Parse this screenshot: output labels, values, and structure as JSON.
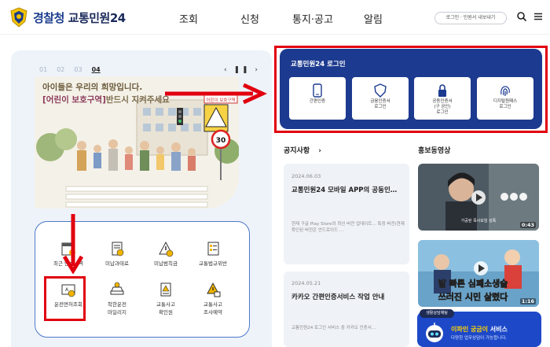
{
  "header": {
    "logo_part1": "경찰청",
    "logo_part2": "교통민원24",
    "nav": [
      "조회",
      "신청",
      "통지·공고",
      "알림"
    ],
    "login_pill": "로그인 · 민원서 내보내기",
    "icons": [
      "search-icon",
      "menu-icon"
    ]
  },
  "banner": {
    "slide_numbers": [
      "01",
      "02",
      "03",
      "04"
    ],
    "active_slide": "04",
    "controls": "‹ ❚❚ ›",
    "title_line1": "아이들은 우리의 희망입니다.",
    "title_line2_highlight": "[어린이 보호구역]",
    "title_line2_rest": "반드시 지켜주세요",
    "speed_sign": "30",
    "zone_sign": "어린이 보호구역"
  },
  "services": [
    {
      "label": "최근 단속내역",
      "icon": "calendar-icon"
    },
    {
      "label": "미납과태료",
      "icon": "coin-doc-icon"
    },
    {
      "label": "미납범칙금",
      "icon": "warning-coin-icon"
    },
    {
      "label": "교통법규위반",
      "icon": "doc-list-icon"
    },
    {
      "label": "운전면허조회",
      "icon": "license-icon"
    },
    {
      "label": "착한운전\n마일리지",
      "icon": "car-coin-icon"
    },
    {
      "label": "교통사고\n확인원",
      "icon": "accident-doc-icon"
    },
    {
      "label": "교통사고\n조사예약",
      "icon": "accident-calendar-icon"
    }
  ],
  "login": {
    "title": "교통민원24 로그인",
    "buttons": [
      {
        "label": "간편인증",
        "icon": "phone-icon"
      },
      {
        "label": "금융인증서\n로그인",
        "icon": "shield-icon"
      },
      {
        "label": "공동인증서\n(구 공인)\n로그인",
        "icon": "lock-icon"
      },
      {
        "label": "디지털원패스\n로그인",
        "icon": "fingerprint-icon"
      }
    ]
  },
  "notices": {
    "title": "공지사항",
    "arrow": "›",
    "items": [
      {
        "date": "2024.06.03",
        "title": "교통민원24 모바일 APP의 공동인…",
        "body": "현재 구글 Play Store의 최신 버전 업데이트… 특정 버전(현재 확인된 버전은 안드로이드 …"
      },
      {
        "date": "2024.05.21",
        "title": "카카오 간편인증서비스 작업 안내",
        "body": "교통민원24 로그인 서비스 중 카카오 인증서…"
      }
    ]
  },
  "videos": {
    "title": "홍보동영상",
    "items": [
      {
        "duration": "0:43",
        "caption": "가공된 목사모임 성폭"
      },
      {
        "duration": "1:16",
        "caption_line1": "발 빠른 심폐소생술",
        "caption_line2": "쓰러진 시민 살렸다"
      }
    ]
  },
  "chat": {
    "badge": "생활상담채팅",
    "title_highlight": "이파인 궁금이",
    "title_rest": " 서비스",
    "subtitle": "다양한 업무상담이 가능합니다."
  },
  "colors": {
    "brand_navy": "#1c3a8f",
    "annotation_red": "#e1000f",
    "service_border": "#4b78c9",
    "chat_blue": "#1d49c9"
  }
}
